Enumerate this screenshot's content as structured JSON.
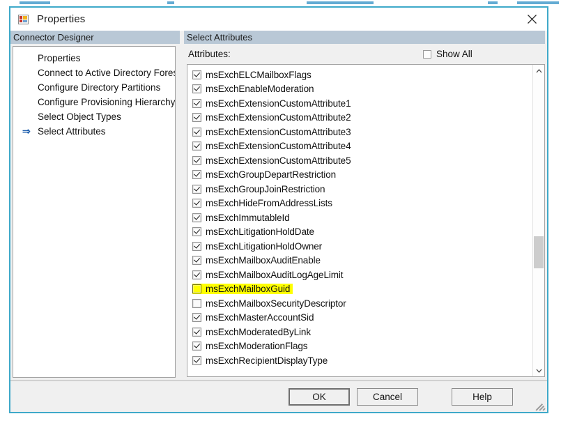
{
  "window": {
    "title": "Properties",
    "icon": "properties-window-icon",
    "close_label": "✕",
    "border_color": "#3fa9c9"
  },
  "left_panel": {
    "header": "Connector Designer",
    "items": [
      {
        "label": "Properties",
        "selected": false
      },
      {
        "label": "Connect to Active Directory Forest",
        "selected": false
      },
      {
        "label": "Configure Directory Partitions",
        "selected": false
      },
      {
        "label": "Configure Provisioning Hierarchy",
        "selected": false
      },
      {
        "label": "Select Object Types",
        "selected": false
      },
      {
        "label": "Select Attributes",
        "selected": true
      }
    ],
    "selected_marker": "⇒"
  },
  "right_panel": {
    "header": "Select Attributes",
    "attributes_label": "Attributes:",
    "show_all": {
      "label": "Show All",
      "checked": false
    },
    "rows": [
      {
        "name": "msExchELCMailboxFlags",
        "checked": true,
        "highlighted": false
      },
      {
        "name": "msExchEnableModeration",
        "checked": true,
        "highlighted": false
      },
      {
        "name": "msExchExtensionCustomAttribute1",
        "checked": true,
        "highlighted": false
      },
      {
        "name": "msExchExtensionCustomAttribute2",
        "checked": true,
        "highlighted": false
      },
      {
        "name": "msExchExtensionCustomAttribute3",
        "checked": true,
        "highlighted": false
      },
      {
        "name": "msExchExtensionCustomAttribute4",
        "checked": true,
        "highlighted": false
      },
      {
        "name": "msExchExtensionCustomAttribute5",
        "checked": true,
        "highlighted": false
      },
      {
        "name": "msExchGroupDepartRestriction",
        "checked": true,
        "highlighted": false
      },
      {
        "name": "msExchGroupJoinRestriction",
        "checked": true,
        "highlighted": false
      },
      {
        "name": "msExchHideFromAddressLists",
        "checked": true,
        "highlighted": false
      },
      {
        "name": "msExchImmutableId",
        "checked": true,
        "highlighted": false
      },
      {
        "name": "msExchLitigationHoldDate",
        "checked": true,
        "highlighted": false
      },
      {
        "name": "msExchLitigationHoldOwner",
        "checked": true,
        "highlighted": false
      },
      {
        "name": "msExchMailboxAuditEnable",
        "checked": true,
        "highlighted": false
      },
      {
        "name": "msExchMailboxAuditLogAgeLimit",
        "checked": true,
        "highlighted": false
      },
      {
        "name": "msExchMailboxGuid",
        "checked": false,
        "highlighted": true
      },
      {
        "name": "msExchMailboxSecurityDescriptor",
        "checked": false,
        "highlighted": false
      },
      {
        "name": "msExchMasterAccountSid",
        "checked": true,
        "highlighted": false
      },
      {
        "name": "msExchModeratedByLink",
        "checked": true,
        "highlighted": false
      },
      {
        "name": "msExchModerationFlags",
        "checked": true,
        "highlighted": false
      },
      {
        "name": "msExchRecipientDisplayType",
        "checked": true,
        "highlighted": false
      }
    ],
    "highlight_color": "#ffff00"
  },
  "footer": {
    "ok_label": "OK",
    "cancel_label": "Cancel",
    "help_label": "Help"
  }
}
